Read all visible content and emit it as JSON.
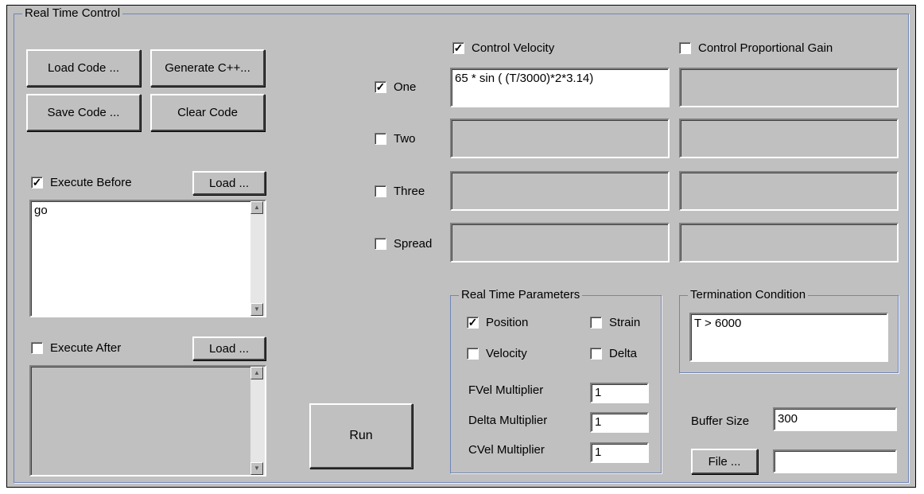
{
  "panel": {
    "title": "Real Time Control"
  },
  "code_buttons": {
    "load": "Load Code ...",
    "generate": "Generate C++...",
    "save": "Save Code ...",
    "clear": "Clear Code"
  },
  "execute_before": {
    "label": "Execute Before",
    "checked": true,
    "load": "Load ...",
    "text": "go"
  },
  "execute_after": {
    "label": "Execute After",
    "checked": false,
    "load": "Load ...",
    "text": ""
  },
  "columns": {
    "velocity": {
      "label": "Control Velocity",
      "checked": true
    },
    "gain": {
      "label": "Control Proportional Gain",
      "checked": false
    }
  },
  "axes": [
    {
      "label": "One",
      "checked": true,
      "velocity": "65 * sin ( (T/3000)*2*3.14)",
      "gain": ""
    },
    {
      "label": "Two",
      "checked": false,
      "velocity": "",
      "gain": ""
    },
    {
      "label": "Three",
      "checked": false,
      "velocity": "",
      "gain": ""
    },
    {
      "label": "Spread",
      "checked": false,
      "velocity": "",
      "gain": ""
    }
  ],
  "run_button": "Run",
  "rt_params": {
    "title": "Real Time Parameters",
    "position": {
      "label": "Position",
      "checked": true
    },
    "strain": {
      "label": "Strain",
      "checked": false
    },
    "velocity": {
      "label": "Velocity",
      "checked": false
    },
    "delta": {
      "label": "Delta",
      "checked": false
    },
    "fvel": {
      "label": "FVel Multiplier",
      "value": "1"
    },
    "delta_mult": {
      "label": "Delta Multiplier",
      "value": "1"
    },
    "cvel": {
      "label": "CVel Multiplier",
      "value": "1"
    }
  },
  "termination": {
    "title": "Termination Condition",
    "value": "T > 6000"
  },
  "buffer": {
    "label": "Buffer Size",
    "value": "300"
  },
  "file": {
    "button": "File ...",
    "value": ""
  },
  "icons": {
    "checkmark": "check-icon",
    "scroll_up": "scroll-up-arrow-icon",
    "scroll_down": "scroll-down-arrow-icon"
  }
}
